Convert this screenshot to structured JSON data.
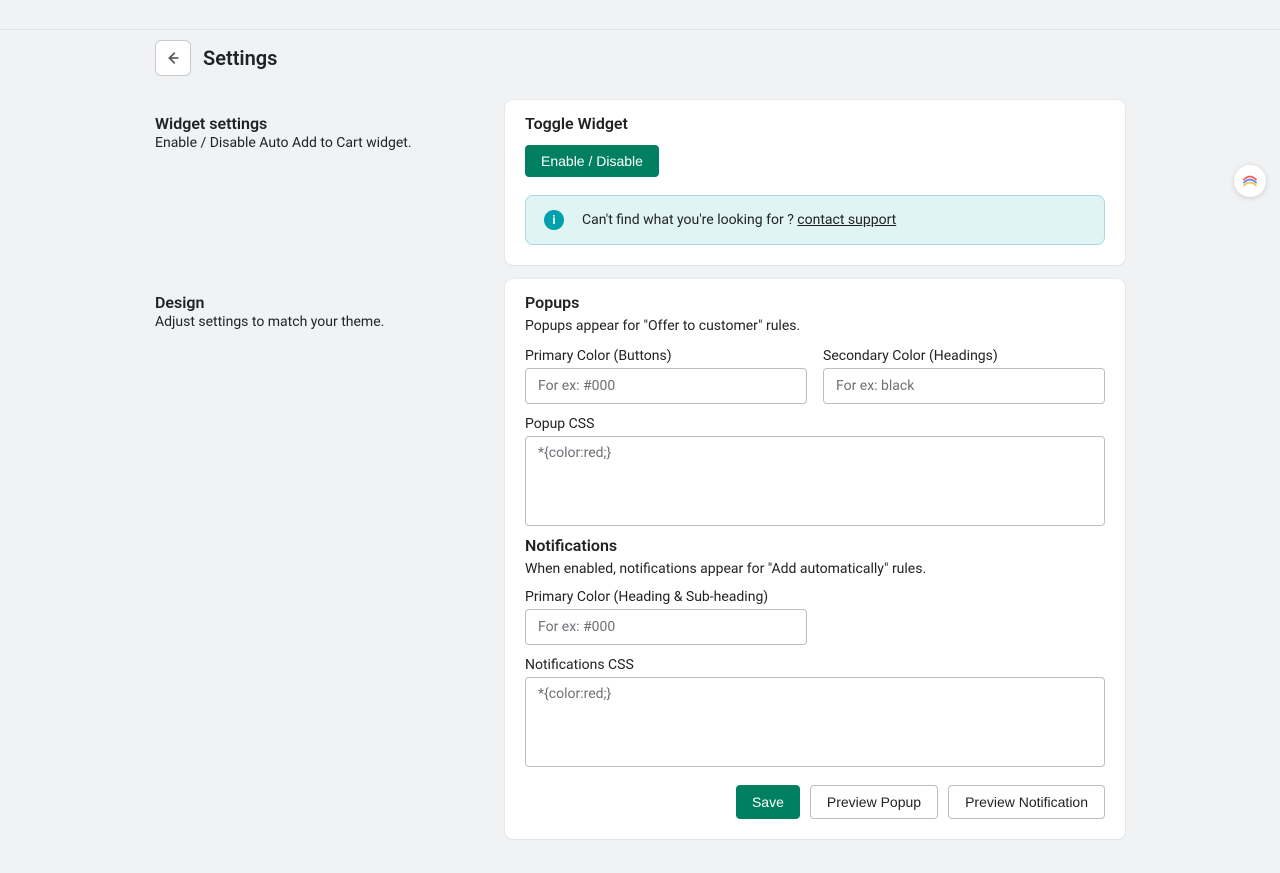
{
  "page": {
    "title": "Settings"
  },
  "sections": {
    "widget": {
      "title": "Widget settings",
      "desc": "Enable / Disable Auto Add to Cart widget.",
      "card_title": "Toggle Widget",
      "toggle_button": "Enable / Disable",
      "banner_text": "Can't find what you're looking for ? ",
      "banner_link": "contact support"
    },
    "design": {
      "title": "Design",
      "desc": "Adjust settings to match your theme.",
      "popups": {
        "title": "Popups",
        "desc": "Popups appear for \"Offer to customer\" rules.",
        "primary_color_label": "Primary Color (Buttons)",
        "primary_color_placeholder": "For ex: #000",
        "primary_color_value": "",
        "secondary_color_label": "Secondary Color (Headings)",
        "secondary_color_placeholder": "For ex: black",
        "secondary_color_value": "",
        "css_label": "Popup CSS",
        "css_placeholder": "*{color:red;}",
        "css_value": ""
      },
      "notifications": {
        "title": "Notifications",
        "desc": "When enabled, notifications appear for \"Add automatically\" rules.",
        "primary_color_label": "Primary Color (Heading & Sub-heading)",
        "primary_color_placeholder": "For ex: #000",
        "primary_color_value": "",
        "css_label": "Notifications CSS",
        "css_placeholder": "*{color:red;}",
        "css_value": ""
      },
      "actions": {
        "save": "Save",
        "preview_popup": "Preview Popup",
        "preview_notification": "Preview Notification"
      }
    }
  }
}
